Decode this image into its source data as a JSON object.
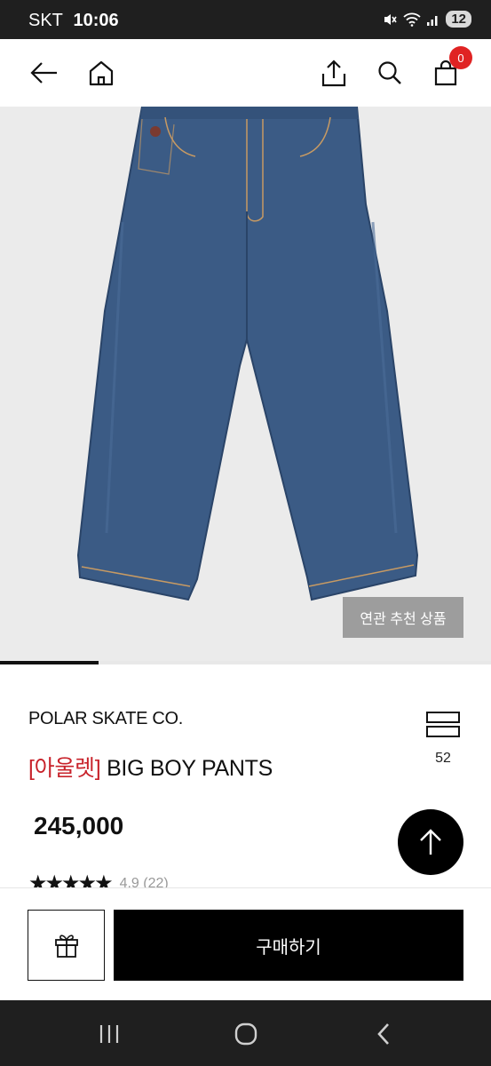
{
  "status_bar": {
    "carrier": "SKT",
    "time": "10:06",
    "battery": "12"
  },
  "product": {
    "related_button_label": "연관 추천 상품",
    "image_progress": 0.2,
    "brand": "POLAR SKATE CO.",
    "name_tag": "[아울렛]",
    "name": "BIG BOY PANTS",
    "wish_count": "52",
    "price": "245,000",
    "rating_stars": 4.5,
    "rating_text": "4.9 (22)"
  },
  "topnav": {
    "cart_count": "0"
  },
  "bottom_bar": {
    "buy_label": "구매하기"
  },
  "colors": {
    "accent_red": "#c8232b",
    "badge_red": "#e02323",
    "denim": "#3b5b85"
  }
}
